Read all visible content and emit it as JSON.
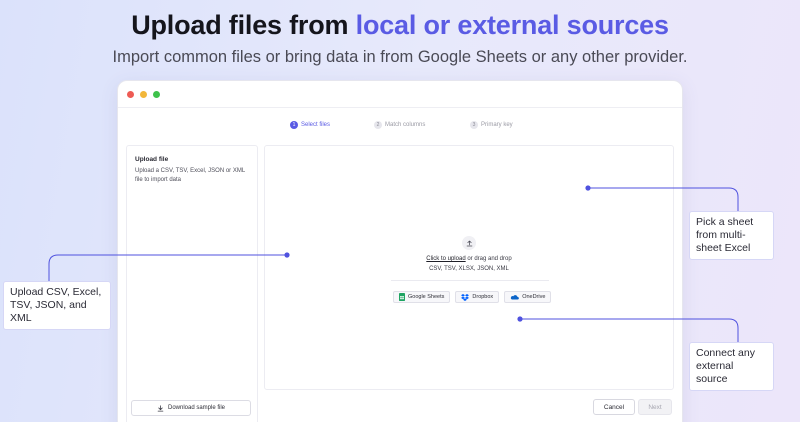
{
  "hero": {
    "title_prefix": "Upload files from ",
    "title_accent": "local or external sources",
    "subtitle": "Import common files or bring data in from Google Sheets or any other provider."
  },
  "stepper": {
    "steps": [
      {
        "num": "1",
        "label": "Select files",
        "state": "active"
      },
      {
        "num": "2",
        "label": "Match columns",
        "state": "inactive"
      },
      {
        "num": "3",
        "label": "Primary key",
        "state": "inactive"
      }
    ]
  },
  "left_panel": {
    "title": "Upload file",
    "description": "Upload a CSV, TSV, Excel, JSON or XML file to import data",
    "sample_button": "Download sample file"
  },
  "upload_area": {
    "link_text": "Click to upload",
    "rest_text": " or drag and drop",
    "formats": "CSV, TSV, XLSX, JSON, XML",
    "providers": [
      "Google Sheets",
      "Dropbox",
      "OneDrive"
    ]
  },
  "footer": {
    "cancel": "Cancel",
    "next": "Next"
  },
  "callouts": {
    "upload_formats": "Upload CSV, Excel, TSV, JSON, and XML",
    "sheet_picker": "Pick a sheet from multi-sheet Excel",
    "external_source": "Connect any external source"
  },
  "colors": {
    "accent": "#5a5be4",
    "connector": "#4f52df",
    "google_sheets": "#1fa463",
    "dropbox": "#0061fe",
    "onedrive": "#0a64c8"
  },
  "icons": {
    "upload": "upload-icon",
    "download": "download-icon",
    "google_sheets": "google-sheets-icon",
    "dropbox": "dropbox-icon",
    "onedrive": "onedrive-icon"
  }
}
